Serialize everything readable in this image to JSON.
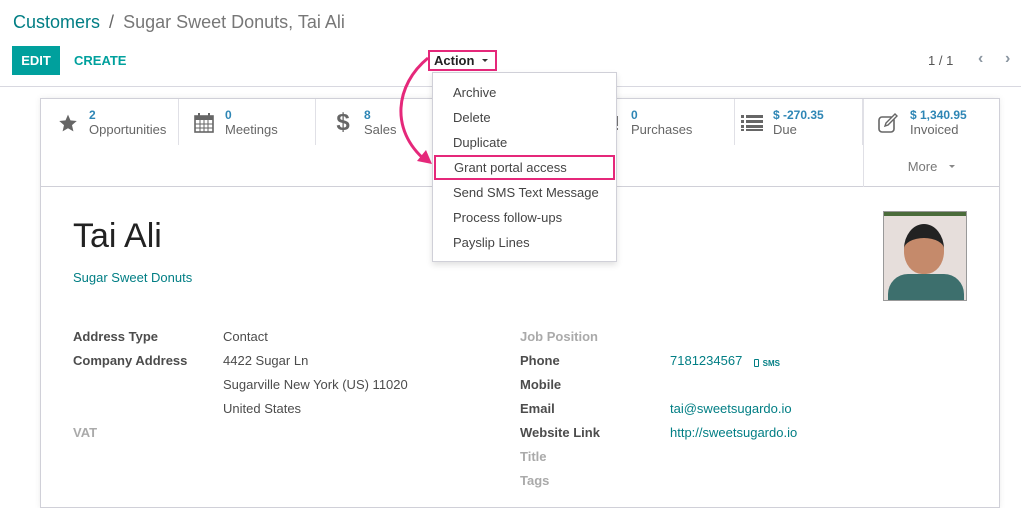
{
  "breadcrumb": {
    "parent": "Customers",
    "separator": "/",
    "current": "Sugar Sweet Donuts, Tai Ali"
  },
  "toolbar": {
    "edit_label": "EDIT",
    "create_label": "CREATE",
    "action_label": "Action"
  },
  "pager": {
    "value": "1 / 1",
    "prev_icon": "chevron-left-icon",
    "next_icon": "chevron-right-icon"
  },
  "action_menu": {
    "items": [
      {
        "label": "Archive"
      },
      {
        "label": "Delete"
      },
      {
        "label": "Duplicate"
      },
      {
        "label": "Grant portal access",
        "highlighted": true
      },
      {
        "label": "Send SMS Text Message"
      },
      {
        "label": "Process follow-ups"
      },
      {
        "label": "Payslip Lines"
      }
    ]
  },
  "smart_buttons": [
    {
      "icon": "star-icon",
      "value": "2",
      "label": "Opportunities"
    },
    {
      "icon": "calendar-icon",
      "value": "0",
      "label": "Meetings"
    },
    {
      "icon": "dollar-icon",
      "value": "8",
      "label": "Sales"
    },
    {
      "icon": "credit-card-icon",
      "value": "0",
      "label": "Purchases"
    },
    {
      "icon": "list-icon",
      "value": "$ -270.35",
      "label": "Due"
    },
    {
      "icon": "edit-icon",
      "value": "$ 1,340.95",
      "label": "Invoiced"
    }
  ],
  "more_label": "More",
  "contact": {
    "name": "Tai Ali",
    "company": "Sugar Sweet Donuts"
  },
  "left_fields": {
    "address_type_label": "Address Type",
    "address_type_value": "Contact",
    "company_address_label": "Company Address",
    "street": "4422 Sugar Ln",
    "city_line": "Sugarville  New York (US)  11020",
    "country": "United States",
    "vat_label": "VAT"
  },
  "right_fields": {
    "job_position_label": "Job Position",
    "phone_label": "Phone",
    "phone_value": "7181234567",
    "sms_label": "SMS",
    "mobile_label": "Mobile",
    "email_label": "Email",
    "email_value": "tai@sweetsugardo.io",
    "website_label": "Website Link",
    "website_value": "http://sweetsugardo.io",
    "title_label": "Title",
    "tags_label": "Tags"
  },
  "colors": {
    "accent": "#00a09d",
    "link": "#017e84",
    "highlight": "#e5287a",
    "stat_value": "#2e86b5"
  }
}
